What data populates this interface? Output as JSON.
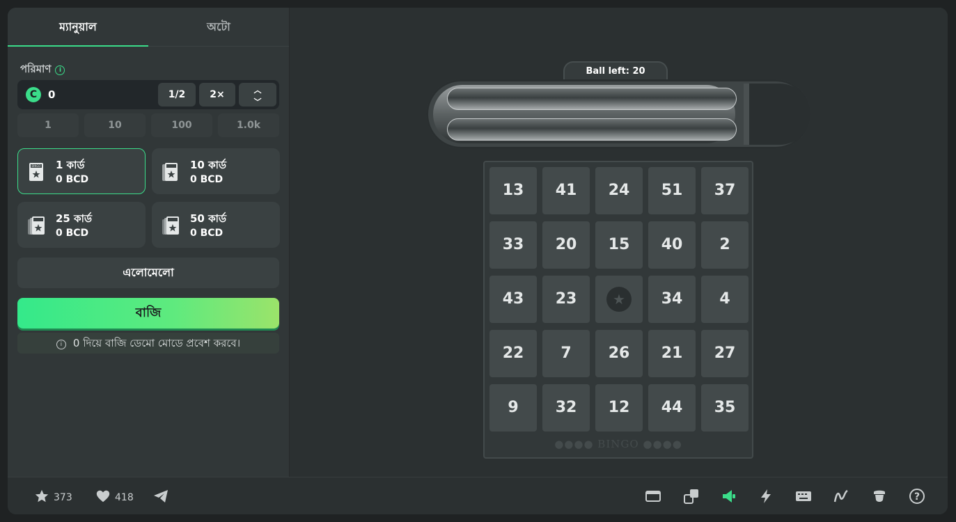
{
  "tabs": [
    {
      "label": "ম্যানুয়াল",
      "active": true
    },
    {
      "label": "অটো",
      "active": false
    }
  ],
  "amount": {
    "label": "পরিমাণ",
    "value": "0",
    "coin_symbol": "C",
    "half_label": "1/2",
    "double_label": "2×"
  },
  "quick_amounts": [
    "1",
    "10",
    "100",
    "1.0k"
  ],
  "card_options": [
    {
      "title": "1 কার্ড",
      "price": "0 BCD",
      "active": true
    },
    {
      "title": "10 কার্ড",
      "price": "0 BCD",
      "active": false
    },
    {
      "title": "25 কার্ড",
      "price": "0 BCD",
      "active": false
    },
    {
      "title": "50 কার্ড",
      "price": "0 BCD",
      "active": false
    }
  ],
  "card_icon_text": "BINGO",
  "random_label": "এলোমেলো",
  "bet_label": "বাজি",
  "demo_note": "0 দিয়ে বাজি ডেমো মোডে প্রবেশ করবে।",
  "ball_left": "Ball left: 20",
  "board": {
    "rows": [
      [
        "13",
        "41",
        "24",
        "51",
        "37"
      ],
      [
        "33",
        "20",
        "15",
        "40",
        "2"
      ],
      [
        "43",
        "23",
        "★",
        "34",
        "4"
      ],
      [
        "22",
        "7",
        "26",
        "21",
        "27"
      ],
      [
        "9",
        "32",
        "12",
        "44",
        "35"
      ]
    ],
    "footer": "●●●●  BINGO  ●●●●"
  },
  "stats": {
    "favorites": "373",
    "likes": "418"
  },
  "colors": {
    "accent": "#3bdd8a",
    "panel": "#313738",
    "background": "#2b3031"
  }
}
